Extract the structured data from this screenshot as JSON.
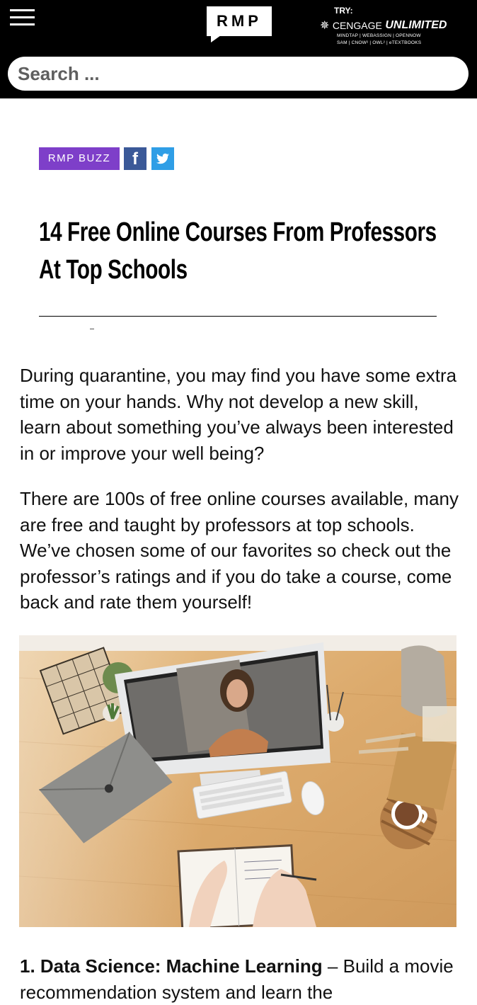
{
  "header": {
    "logo_text": "RMP",
    "promo": {
      "try_label": "TRY:",
      "brand_prefix": "CENGAGE",
      "brand_name": "UNLIMITED",
      "products_line1": "MINDTAP | WEBASSIGN | OPENNOW",
      "products_line2": "SAM | CNOW² | OWL² | eTEXTBOOKS"
    },
    "search": {
      "placeholder": "Search ..."
    }
  },
  "article": {
    "category": "RMP BUZZ",
    "share": {
      "facebook_glyph": "f"
    },
    "title_line1": "14 Free Online Courses From Professors",
    "title_line2": "At Top Schools",
    "dash": "-",
    "paragraphs": [
      "During quarantine, you may find you have some extra time on your hands. Why not develop a new skill, learn about something you’ve always been interested in or improve your well being?",
      "There are 100s of free online courses available, many are free and taught by professors at top schools. We’ve chosen some of our favorites so check out the professor’s ratings and if you do take a course, come back and rate them yourself!"
    ],
    "first_item": {
      "heading": "1. Data Science: Machine Learning",
      "text": " – Build a movie recommendation system and learn the"
    }
  },
  "colors": {
    "header_bg": "#000000",
    "category_tag": "#7e3fc9",
    "facebook": "#3b5998",
    "twitter": "#2f9ee6"
  },
  "icons": [
    "menu-icon",
    "facebook-icon",
    "twitter-icon",
    "cengage-spark-icon"
  ]
}
